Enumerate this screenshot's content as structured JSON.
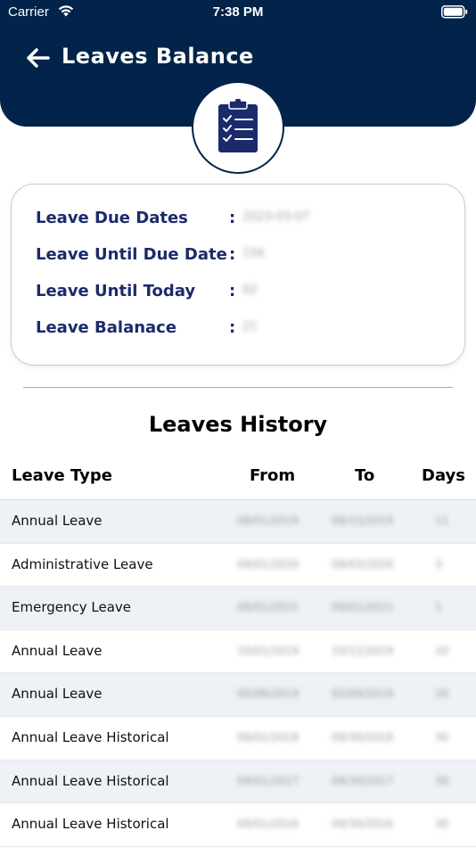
{
  "status_bar": {
    "carrier": "Carrier",
    "time": "7:38 PM"
  },
  "header": {
    "title": "Leaves Balance",
    "back_icon": "arrow-left-icon",
    "badge_icon": "clipboard-checklist-icon",
    "color": "#02234a"
  },
  "summary": {
    "rows": [
      {
        "label": "Leave Due Dates",
        "colon": ":",
        "value": "2023-03-07"
      },
      {
        "label": "Leave Until Due Date",
        "colon": ":",
        "value": "156"
      },
      {
        "label": "Leave Until Today",
        "colon": ":",
        "value": "62"
      },
      {
        "label": "Leave Balanace",
        "colon": ":",
        "value": "21"
      }
    ]
  },
  "history": {
    "title": "Leaves History",
    "columns": {
      "type": "Leave Type",
      "from": "From",
      "to": "To",
      "days": "Days"
    },
    "rows": [
      {
        "type": "Annual Leave",
        "from": "08/01/2019",
        "to": "08/15/2019",
        "days": "11"
      },
      {
        "type": "Administrative Leave",
        "from": "09/01/2020",
        "to": "09/03/2020",
        "days": "3"
      },
      {
        "type": "Emergency Leave",
        "from": "09/01/2021",
        "to": "09/01/2021",
        "days": "1"
      },
      {
        "type": "Annual Leave",
        "from": "10/01/2019",
        "to": "10/12/2019",
        "days": "10"
      },
      {
        "type": "Annual Leave",
        "from": "05/06/2019",
        "to": "05/09/2019",
        "days": "20"
      },
      {
        "type": "Annual Leave Historical",
        "from": "09/01/2018",
        "to": "09/30/2018",
        "days": "30"
      },
      {
        "type": "Annual Leave Historical",
        "from": "09/01/2017",
        "to": "09/30/2017",
        "days": "30"
      },
      {
        "type": "Annual Leave Historical",
        "from": "09/01/2016",
        "to": "09/30/2016",
        "days": "30"
      }
    ]
  }
}
